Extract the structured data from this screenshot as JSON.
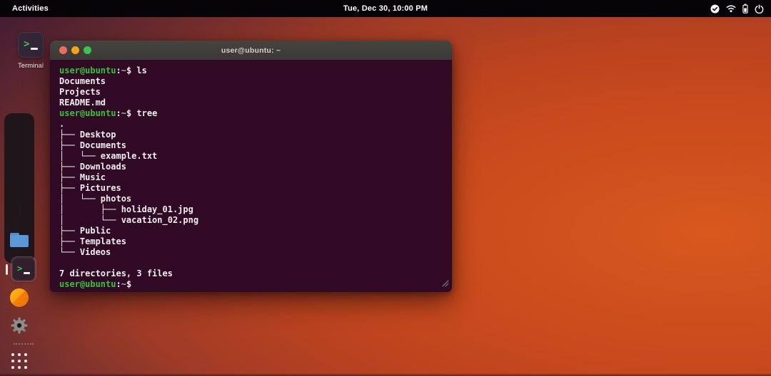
{
  "top_bar": {
    "activities_label": "Activities",
    "clock": "Tue, Dec 30, 10:00 PM",
    "status_icons": [
      "checkmark-circle",
      "wifi",
      "battery",
      "power"
    ]
  },
  "desktop": {
    "shortcut_label": "Terminal"
  },
  "dock": {
    "items": [
      "files",
      "terminal",
      "software",
      "settings",
      "app-grid"
    ],
    "active_item": "terminal"
  },
  "terminal": {
    "title": "user@ubuntu: ~",
    "prompt": {
      "user": "user@ubuntu",
      "colon": ":",
      "path": "~",
      "dollar": "$"
    },
    "lines": [
      {
        "type": "prompt",
        "command": "ls"
      },
      {
        "type": "output",
        "text": "Documents"
      },
      {
        "type": "output",
        "text": "Projects"
      },
      {
        "type": "output",
        "text": "README.md"
      },
      {
        "type": "prompt",
        "command": "tree"
      },
      {
        "type": "output",
        "text": "."
      },
      {
        "type": "output",
        "text": "├── Desktop"
      },
      {
        "type": "output",
        "text": "├── Documents"
      },
      {
        "type": "output",
        "text": "│   └── example.txt"
      },
      {
        "type": "output",
        "text": "├── Downloads"
      },
      {
        "type": "output",
        "text": "├── Music"
      },
      {
        "type": "output",
        "text": "├── Pictures"
      },
      {
        "type": "output",
        "text": "│   └── photos"
      },
      {
        "type": "output",
        "text": "│       ├── holiday_01.jpg"
      },
      {
        "type": "output",
        "text": "│       └── vacation_02.png"
      },
      {
        "type": "output",
        "text": "├── Public"
      },
      {
        "type": "output",
        "text": "├── Templates"
      },
      {
        "type": "output",
        "text": "└── Videos"
      },
      {
        "type": "output",
        "text": ""
      },
      {
        "type": "output",
        "text": "7 directories, 3 files"
      },
      {
        "type": "prompt",
        "command": ""
      }
    ],
    "colors": {
      "background": "#300a24",
      "titlebar": "#3e3b37",
      "prompt_green": "#33c533",
      "text": "#f2edf1",
      "path_dim": "#b3aab1",
      "light_red": "#ee6b5f",
      "light_yellow": "#f6a312",
      "light_green": "#38c74c"
    }
  }
}
